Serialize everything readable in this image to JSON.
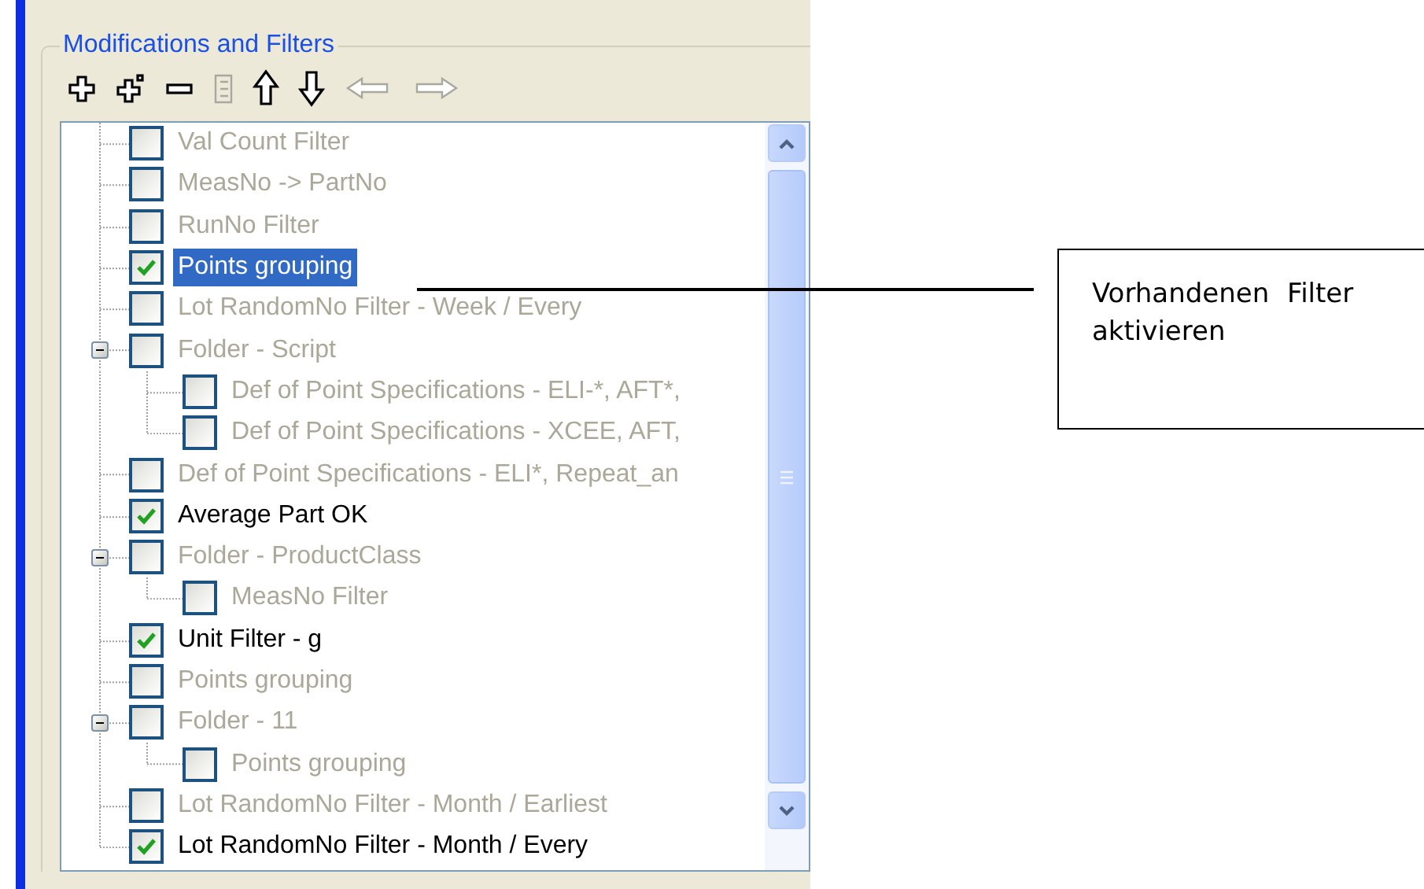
{
  "group": {
    "title": "Modifications and Filters"
  },
  "toolbar": [
    {
      "kind": "add",
      "disabled": false
    },
    {
      "kind": "add_child",
      "disabled": false
    },
    {
      "kind": "remove",
      "disabled": false
    },
    {
      "kind": "edit",
      "disabled": true
    },
    {
      "kind": "up",
      "disabled": false
    },
    {
      "kind": "down",
      "disabled": false
    },
    {
      "kind": "left",
      "disabled": true
    },
    {
      "kind": "right",
      "disabled": true
    }
  ],
  "tree": {
    "items": [
      {
        "label": "Val Count Filter",
        "checked": false,
        "selected": false
      },
      {
        "label": "MeasNo -> PartNo",
        "checked": false,
        "selected": false
      },
      {
        "label": "RunNo Filter",
        "checked": false,
        "selected": false
      },
      {
        "label": "Points grouping",
        "checked": true,
        "selected": true
      },
      {
        "label": "Lot RandomNo Filter - Week / Every",
        "checked": false,
        "selected": false
      },
      {
        "label": "Folder - Script",
        "checked": false,
        "selected": false,
        "expanded": true,
        "children": [
          {
            "label": "Def of Point Specifications - ELI-*, AFT*,",
            "checked": false,
            "selected": false
          },
          {
            "label": "Def of Point Specifications - XCEE, AFT,",
            "checked": false,
            "selected": false
          }
        ]
      },
      {
        "label": "Def of Point Specifications - ELI*, Repeat_an",
        "checked": false,
        "selected": false
      },
      {
        "label": "Average Part OK",
        "checked": true,
        "selected": false
      },
      {
        "label": "Folder - ProductClass",
        "checked": false,
        "selected": false,
        "expanded": true,
        "children": [
          {
            "label": "MeasNo Filter",
            "checked": false,
            "selected": false
          }
        ]
      },
      {
        "label": "Unit Filter - g",
        "checked": true,
        "selected": false
      },
      {
        "label": "Points grouping",
        "checked": false,
        "selected": false
      },
      {
        "label": "Folder - 11",
        "checked": false,
        "selected": false,
        "expanded": true,
        "children": [
          {
            "label": "Points grouping",
            "checked": false,
            "selected": false
          }
        ]
      },
      {
        "label": "Lot RandomNo Filter - Month / Earliest",
        "checked": false,
        "selected": false
      },
      {
        "label": "Lot RandomNo Filter - Month / Every",
        "checked": true,
        "selected": false
      }
    ]
  },
  "callout": {
    "text": "Vorhandenen Filter aktivieren"
  }
}
